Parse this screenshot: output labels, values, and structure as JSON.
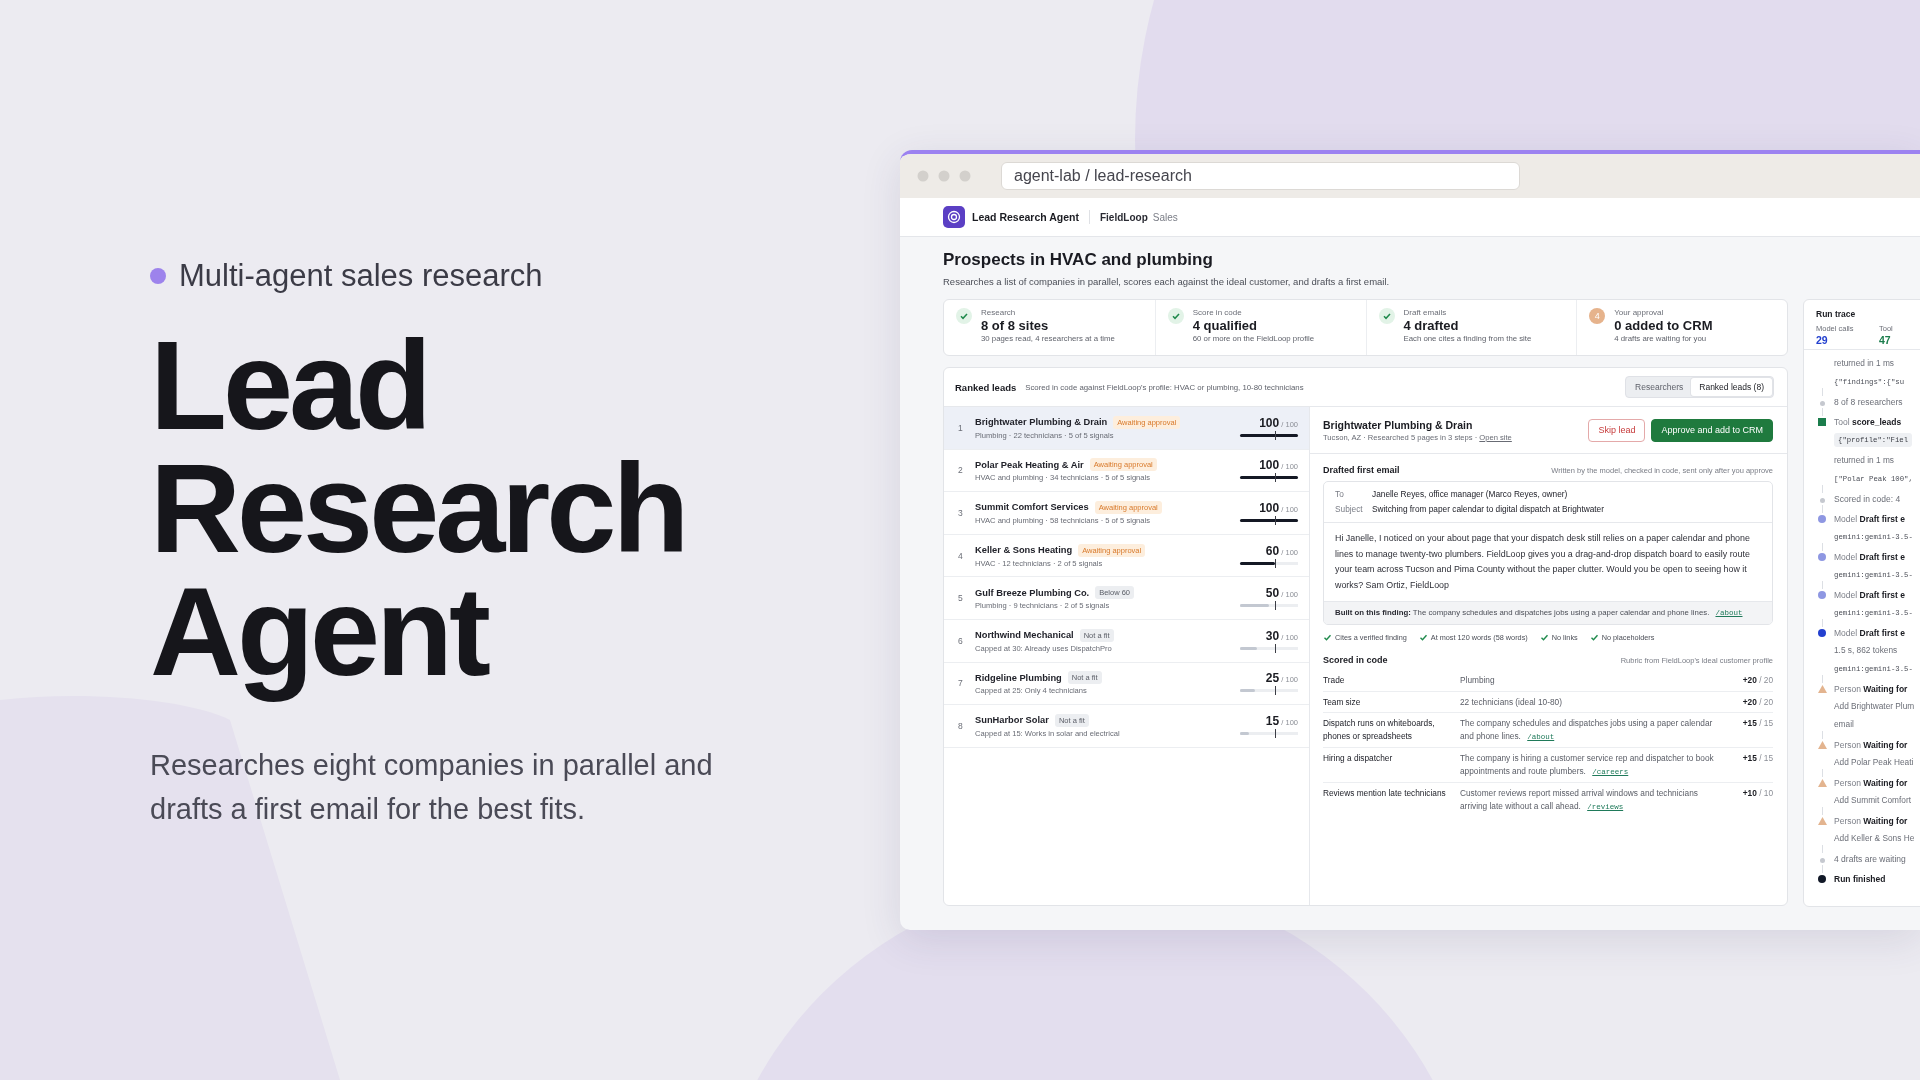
{
  "hero": {
    "eyebrow": "Multi-agent sales research",
    "title": "Lead Research Agent",
    "description": "Researches eight companies in parallel and drafts a first email for the best fits."
  },
  "browser": {
    "address": "agent-lab / lead-research"
  },
  "app": {
    "name": "Lead Research Agent",
    "workspace": "FieldLoop",
    "workspace_role": "Sales"
  },
  "page": {
    "title": "Prospects in HVAC and plumbing",
    "subtitle": "Researches a list of companies in parallel, scores each against the ideal customer, and drafts a first email."
  },
  "stages": [
    {
      "label": "Research",
      "value": "8 of 8 sites",
      "note": "30 pages read, 4 researchers at a time",
      "kind": "done"
    },
    {
      "label": "Score in code",
      "value": "4 qualified",
      "note": "60 or more on the FieldLoop profile",
      "kind": "done"
    },
    {
      "label": "Draft emails",
      "value": "4 drafted",
      "note": "Each one cites a finding from the site",
      "kind": "done"
    },
    {
      "label": "Your approval",
      "value": "0 added to CRM",
      "note": "4 drafts are waiting for you",
      "kind": "pending",
      "count": "4"
    }
  ],
  "leads_panel": {
    "title": "Ranked leads",
    "description": "Scored in code against FieldLoop's profile: HVAC or plumbing, 10-80 technicians",
    "tabs": [
      {
        "label": "Researchers",
        "selected": false
      },
      {
        "label": "Ranked leads (8)",
        "selected": true
      }
    ]
  },
  "leads": [
    {
      "rank": "1",
      "name": "Brightwater Plumbing & Drain",
      "status": {
        "text": "Awaiting approval",
        "kind": "awaiting"
      },
      "summary": "Plumbing · 22 technicians · 5 of 5 signals",
      "score": "100",
      "max": "/ 100",
      "level": 1,
      "selected": true
    },
    {
      "rank": "2",
      "name": "Polar Peak Heating & Air",
      "status": {
        "text": "Awaiting approval",
        "kind": "awaiting"
      },
      "summary": "HVAC and plumbing · 34 technicians · 5 of 5 signals",
      "score": "100",
      "max": "/ 100",
      "level": 1,
      "selected": false
    },
    {
      "rank": "3",
      "name": "Summit Comfort Services",
      "status": {
        "text": "Awaiting approval",
        "kind": "awaiting"
      },
      "summary": "HVAC and plumbing · 58 technicians · 5 of 5 signals",
      "score": "100",
      "max": "/ 100",
      "level": 1,
      "selected": false
    },
    {
      "rank": "4",
      "name": "Keller & Sons Heating",
      "status": {
        "text": "Awaiting approval",
        "kind": "awaiting"
      },
      "summary": "HVAC · 12 technicians · 2 of 5 signals",
      "score": "60",
      "max": "/ 100",
      "level": 0.6,
      "selected": false
    },
    {
      "rank": "5",
      "name": "Gulf Breeze Plumbing Co.",
      "status": {
        "text": "Below 60",
        "kind": "below"
      },
      "summary": "Plumbing · 9 technicians · 2 of 5 signals",
      "score": "50",
      "max": "/ 100",
      "level": 0.5,
      "selected": false
    },
    {
      "rank": "6",
      "name": "Northwind Mechanical",
      "status": {
        "text": "Not a fit",
        "kind": "unfit"
      },
      "summary": "Capped at 30: Already uses DispatchPro",
      "score": "30",
      "max": "/ 100",
      "level": 0.3,
      "selected": false
    },
    {
      "rank": "7",
      "name": "Ridgeline Plumbing",
      "status": {
        "text": "Not a fit",
        "kind": "unfit"
      },
      "summary": "Capped at 25: Only 4 technicians",
      "score": "25",
      "max": "/ 100",
      "level": 0.25,
      "selected": false
    },
    {
      "rank": "8",
      "name": "SunHarbor Solar",
      "status": {
        "text": "Not a fit",
        "kind": "unfit"
      },
      "summary": "Capped at 15: Works in solar and electrical",
      "score": "15",
      "max": "/ 100",
      "level": 0.15,
      "selected": false
    }
  ],
  "detail": {
    "name": "Brightwater Plumbing & Drain",
    "meta": "Tucson, AZ · Researched 5 pages in 3 steps ·",
    "link": "Open site",
    "actions": [
      {
        "label": "Skip lead",
        "kind": "secondary"
      },
      {
        "label": "Approve and add to CRM",
        "kind": "primary"
      }
    ],
    "email": {
      "title": "Drafted first email",
      "note": "Written by the model, checked in code, sent only after you approve",
      "fields": [
        {
          "label": "To",
          "value": "Janelle Reyes, office manager (Marco Reyes, owner)"
        },
        {
          "label": "Subject",
          "value": "Switching from paper calendar to digital dispatch at Brightwater"
        }
      ],
      "body": "Hi Janelle, I noticed on your about page that your dispatch desk still relies on a paper calendar and phone lines to manage twenty-two plumbers. FieldLoop gives you a drag-and-drop dispatch board to easily route your team across Tucson and Pima County without the paper clutter. Would you be open to seeing how it works? Sam Ortiz, FieldLoop",
      "finding": "**Built on this finding:** The company schedules and dispatches jobs using a paper calendar and phone lines.",
      "finding_source": "/about",
      "checks": [
        {
          "label": "Cites a verified finding",
          "passed": true
        },
        {
          "label": "At most 120 words (58 words)",
          "passed": true
        },
        {
          "label": "No links",
          "passed": true
        },
        {
          "label": "No placeholders",
          "passed": true
        }
      ]
    },
    "scoring": {
      "title": "Scored in code",
      "note": "Rubric from FieldLoop's ideal customer profile",
      "rows": [
        {
          "criterion": "Trade",
          "evidence": "Plumbing",
          "points": "+20",
          "max": "/ 20"
        },
        {
          "criterion": "Team size",
          "evidence": "22 technicians (ideal 10-80)",
          "points": "+20",
          "max": "/ 20"
        },
        {
          "criterion": "Dispatch runs on whiteboards, phones or spreadsheets",
          "evidence": "The company schedules and dispatches jobs using a paper calendar and phone lines.",
          "source": "/about",
          "points": "+15",
          "max": "/ 15"
        },
        {
          "criterion": "Hiring a dispatcher",
          "evidence": "The company is hiring a customer service rep and dispatcher to book appointments and route plumbers.",
          "source": "/careers",
          "points": "+15",
          "max": "/ 15"
        },
        {
          "criterion": "Reviews mention late technicians",
          "evidence": "Customer reviews report missed arrival windows and technicians arriving late without a call ahead.",
          "source": "/reviews",
          "points": "+10",
          "max": "/ 10"
        }
      ]
    }
  },
  "trace": {
    "title": "Run trace",
    "stats": [
      {
        "label": "Model calls",
        "value": "29",
        "kind": "model"
      },
      {
        "label": "Tool",
        "value": "47",
        "kind": "tool"
      }
    ],
    "events": [
      {
        "kind": "continuation",
        "lines": [
          {
            "text": "returned in 1 ms",
            "kind": "meta"
          },
          {
            "text": "{\"findings\":{\"su",
            "kind": "code"
          }
        ]
      },
      {
        "kind": "note",
        "color": "#c5c8cf",
        "title": "8 of 8 researchers"
      },
      {
        "kind": "tool",
        "color": "#1b7d4c",
        "actor": "Tool",
        "title": "score_leads",
        "lines": [
          {
            "text": "{\"profile\":\"Fiel",
            "kind": "codebox"
          },
          {
            "text": "returned in 1 ms",
            "kind": "meta"
          },
          {
            "text": "[\"Polar Peak 100\",",
            "kind": "code"
          }
        ]
      },
      {
        "kind": "note",
        "color": "#c5c8cf",
        "title": "Scored in code: 4"
      },
      {
        "kind": "model",
        "color": "#8e97e2",
        "actor": "Model",
        "title": "Draft first e",
        "lines": [
          {
            "text": "gemini:gemini-3.5-",
            "kind": "code"
          }
        ]
      },
      {
        "kind": "model",
        "color": "#8e97e2",
        "actor": "Model",
        "title": "Draft first e",
        "lines": [
          {
            "text": "gemini:gemini-3.5-",
            "kind": "code"
          }
        ]
      },
      {
        "kind": "model",
        "color": "#8e97e2",
        "actor": "Model",
        "title": "Draft first e",
        "lines": [
          {
            "text": "gemini:gemini-3.5-",
            "kind": "code"
          }
        ]
      },
      {
        "kind": "model",
        "color": "#2340cf",
        "actor": "Model",
        "title": "Draft first e",
        "lines": [
          {
            "text": "1.5 s, 862 tokens",
            "kind": "meta"
          },
          {
            "text": "gemini:gemini-3.5-",
            "kind": "code"
          }
        ]
      },
      {
        "kind": "person",
        "color": "#e3b48f",
        "actor": "Person",
        "title": "Waiting for",
        "lines": [
          {
            "text": "Add Brightwater Plum",
            "kind": "meta"
          },
          {
            "text": "email",
            "kind": "meta"
          }
        ]
      },
      {
        "kind": "person",
        "color": "#e3b48f",
        "actor": "Person",
        "title": "Waiting for",
        "lines": [
          {
            "text": "Add Polar Peak Heati",
            "kind": "meta"
          }
        ]
      },
      {
        "kind": "person",
        "color": "#e3b48f",
        "actor": "Person",
        "title": "Waiting for",
        "lines": [
          {
            "text": "Add Summit Comfort",
            "kind": "meta"
          }
        ]
      },
      {
        "kind": "person",
        "color": "#e3b48f",
        "actor": "Person",
        "title": "Waiting for",
        "lines": [
          {
            "text": "Add Keller & Sons He",
            "kind": "meta"
          }
        ]
      },
      {
        "kind": "note",
        "color": "#c5c8cf",
        "title": "4 drafts are waiting"
      },
      {
        "kind": "end",
        "color": "#111827",
        "title": "Run finished"
      }
    ]
  }
}
